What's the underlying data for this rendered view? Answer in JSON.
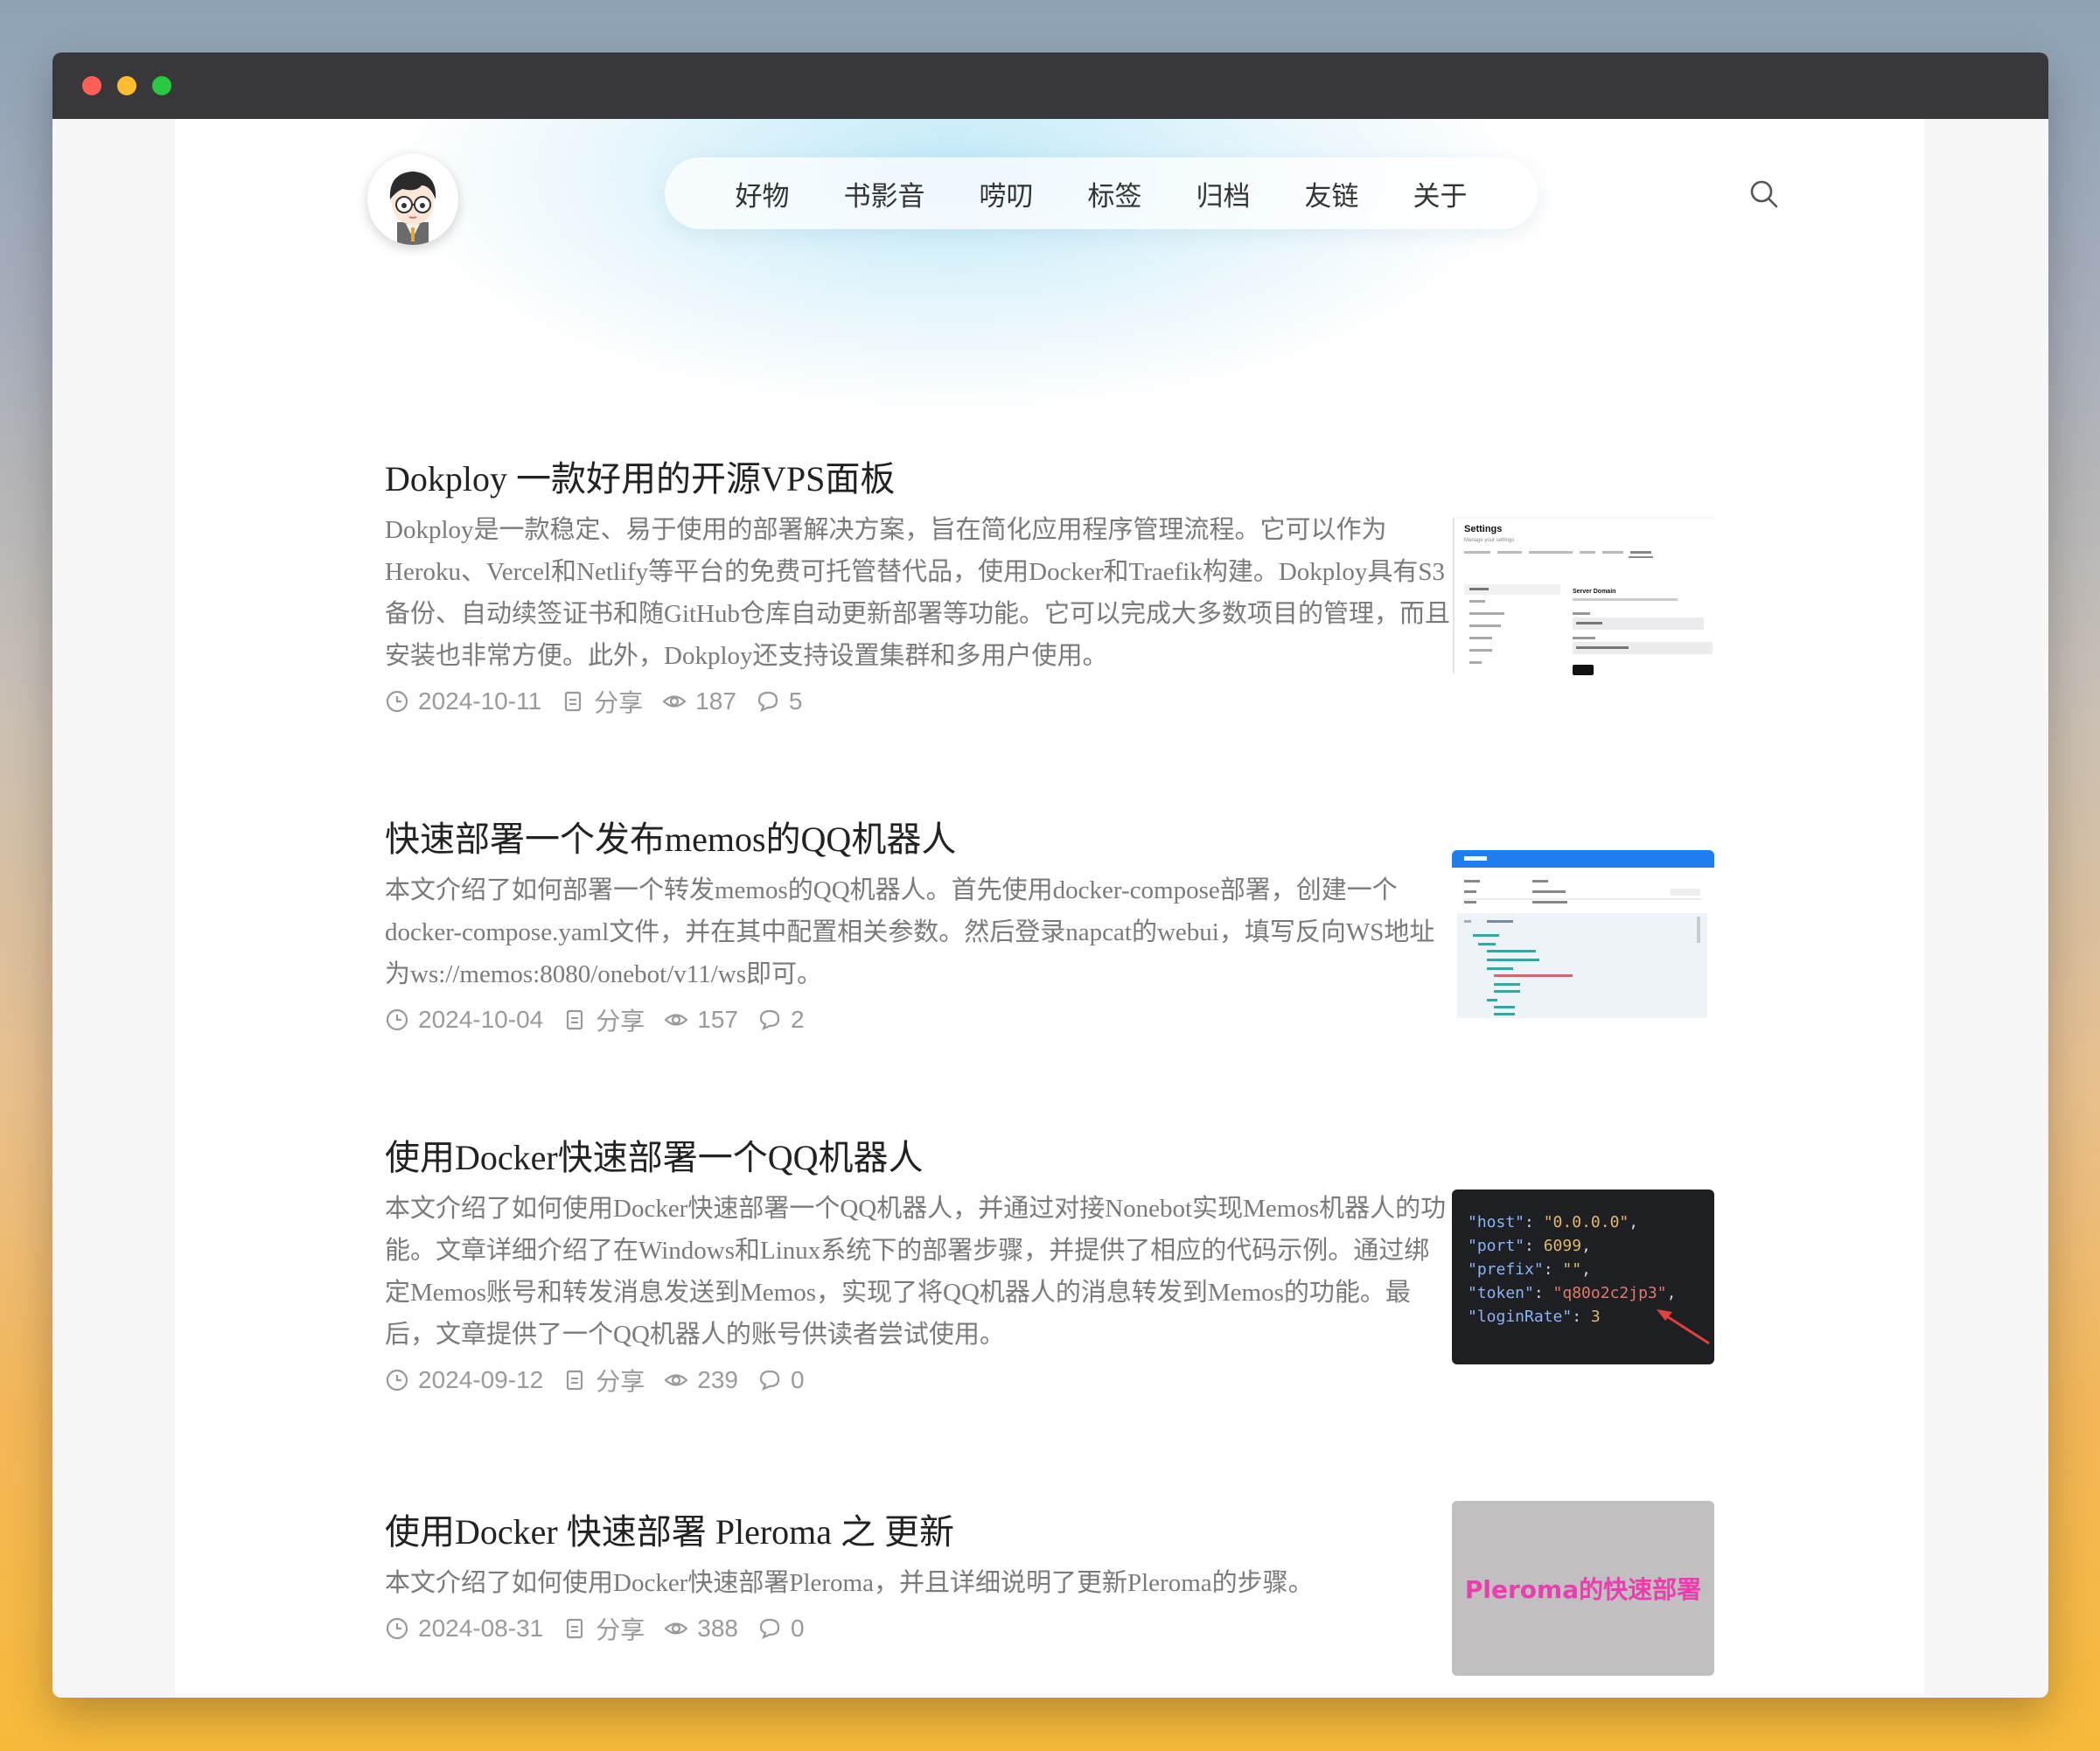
{
  "nav": {
    "items": [
      "好物",
      "书影音",
      "唠叨",
      "标签",
      "归档",
      "友链",
      "关于"
    ]
  },
  "posts": [
    {
      "title": "Dokploy 一款好用的开源VPS面板",
      "summary": "Dokploy是一款稳定、易于使用的部署解决方案，旨在简化应用程序管理流程。它可以作为Heroku、Vercel和Netlify等平台的免费可托管替代品，使用Docker和Traefik构建。Dokploy具有S3备份、自动续签证书和随GitHub仓库自动更新部署等功能。它可以完成大多数项目的管理，而且安装也非常方便。此外，Dokploy还支持设置集群和多用户使用。",
      "date": "2024-10-11",
      "category": "分享",
      "views": "187",
      "comments": "5",
      "thumb": {
        "heading": "Settings",
        "subheading": "Manage your settings",
        "section": "Server Domain"
      }
    },
    {
      "title": "快速部署一个发布memos的QQ机器人",
      "summary": "本文介绍了如何部署一个转发memos的QQ机器人。首先使用docker-compose部署，创建一个docker-compose.yaml文件，并在其中配置相关参数。然后登录napcat的webui，填写反向WS地址为ws://memos:8080/onebot/v11/ws即可。",
      "date": "2024-10-04",
      "category": "分享",
      "views": "157",
      "comments": "2"
    },
    {
      "title": "使用Docker快速部署一个QQ机器人",
      "summary": "本文介绍了如何使用Docker快速部署一个QQ机器人，并通过对接Nonebot实现Memos机器人的功能。文章详细介绍了在Windows和Linux系统下的部署步骤，并提供了相应的代码示例。通过绑定Memos账号和转发消息发送到Memos，实现了将QQ机器人的消息转发到Memos的功能。最后，文章提供了一个QQ机器人的账号供读者尝试使用。",
      "date": "2024-09-12",
      "category": "分享",
      "views": "239",
      "comments": "0",
      "thumb": {
        "code": [
          {
            "key": "\"host\"",
            "val": "\"0.0.0.0\"",
            "tail": ","
          },
          {
            "key": "\"port\"",
            "val": "6099",
            "tail": ","
          },
          {
            "key": "\"prefix\"",
            "val": "\"\"",
            "tail": ","
          },
          {
            "key": "\"token\"",
            "val": "\"q80o2c2jp3\"",
            "tail": ","
          },
          {
            "key": "\"loginRate\"",
            "val": "3",
            "tail": ""
          }
        ]
      }
    },
    {
      "title": "使用Docker 快速部署 Pleroma 之 更新",
      "summary": "本文介绍了如何使用Docker快速部署Pleroma，并且详细说明了更新Pleroma的步骤。",
      "date": "2024-08-31",
      "category": "分享",
      "views": "388",
      "comments": "0",
      "thumb": {
        "text": "Pleroma的快速部署"
      }
    }
  ],
  "colors": {
    "titlebar": "#38383a",
    "nav_glow": "#bfe8f8",
    "title_text": "#222222",
    "summary_text": "#7a7a7a",
    "meta_text": "#9a9a9a",
    "code_bg": "#1e1f22",
    "pleroma_thumb_bg": "#c2bfc0",
    "pleroma_thumb_text": "#e83fae",
    "memos_header_blue": "#1e7ef0"
  },
  "icons": [
    "clock-icon",
    "document-icon",
    "eye-icon",
    "comment-icon",
    "search-icon"
  ]
}
